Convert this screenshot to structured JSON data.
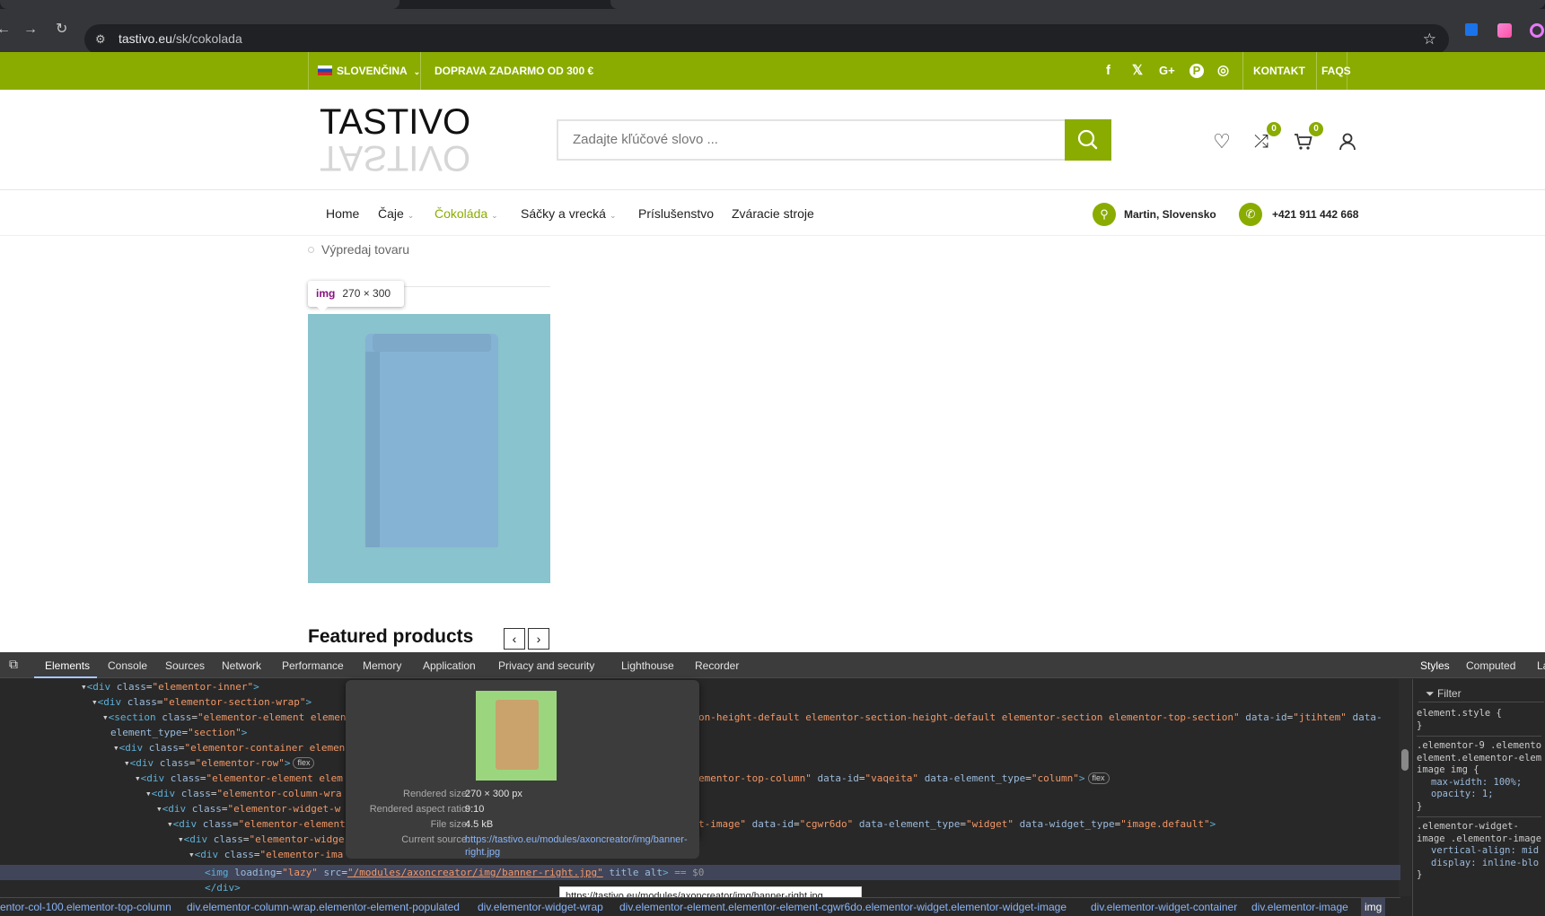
{
  "browser": {
    "url_host": "tastivo.eu",
    "url_path": "/sk/cokolada"
  },
  "topbar": {
    "language": "SLOVENČINA",
    "shipping": "DOPRAVA ZADARMO OD 300 €",
    "social": [
      "f",
      "𝕏",
      "G+",
      "P",
      "◎"
    ],
    "contact": "KONTAKT",
    "faqs": "FAQS"
  },
  "header": {
    "logo_text": "TASTIVO",
    "search_placeholder": "Zadajte kľúčové slovo ...",
    "compare_count": "0",
    "cart_count": "0"
  },
  "nav": {
    "items": [
      {
        "label": "Home",
        "caret": false
      },
      {
        "label": "Čaje",
        "caret": true
      },
      {
        "label": "Čokoláda",
        "caret": true,
        "active": true
      },
      {
        "label": "Sáčky a vrecká",
        "caret": true
      },
      {
        "label": "Príslušenstvo",
        "caret": false
      },
      {
        "label": "Zváracie stroje",
        "caret": false
      }
    ],
    "location": "Martin, Slovensko",
    "phone": "+421 911 442 668"
  },
  "content": {
    "list_item": "Výpredaj tovaru",
    "img_tooltip_tag": "img",
    "img_tooltip_size": "270 × 300",
    "featured_title": "Featured products"
  },
  "devtools": {
    "tabs": [
      "Elements",
      "Console",
      "Sources",
      "Network",
      "Performance",
      "Memory",
      "Application",
      "Privacy and security",
      "Lighthouse",
      "Recorder"
    ],
    "side_tabs": [
      "Styles",
      "Computed",
      "La"
    ],
    "filter": "Filter",
    "popup": {
      "rendered_size_label": "Rendered size:",
      "rendered_size": "270 × 300 px",
      "aspect_label": "Rendered aspect ratio:",
      "aspect": "9:10",
      "file_size_label": "File size:",
      "file_size": "4.5 kB",
      "source_label": "Current source:",
      "source": "https://tastivo.eu/modules/axoncreator/img/banner-right.jpg"
    },
    "url_tooltip": "https://tastivo.eu/modules/axoncreator/img/banner-right.jpg",
    "breadcrumbs": [
      "entor-col-100.elementor-top-column",
      "div.elementor-column-wrap.elementor-element-populated",
      "div.elementor-widget-wrap",
      "div.elementor-element.elementor-element-cgwr6do.elementor-widget.elementor-widget-image",
      "div.elementor-widget-container",
      "div.elementor-image",
      "img"
    ],
    "styles": {
      "element_style": "element.style {",
      "close": "}",
      "rule1_sel": ".elementor-9 .elemento",
      "rule1_sel2": "element.elementor-elem",
      "rule1_sel3": "image img {",
      "rule1_p1": "max-width: 100%;",
      "rule1_p2": "opacity: 1;",
      "rule2_sel": ".elementor-widget-",
      "rule2_sel2": "image .elementor-image",
      "rule2_p1": "vertical-align: mid",
      "rule2_p2": "display: inline-blo"
    }
  }
}
